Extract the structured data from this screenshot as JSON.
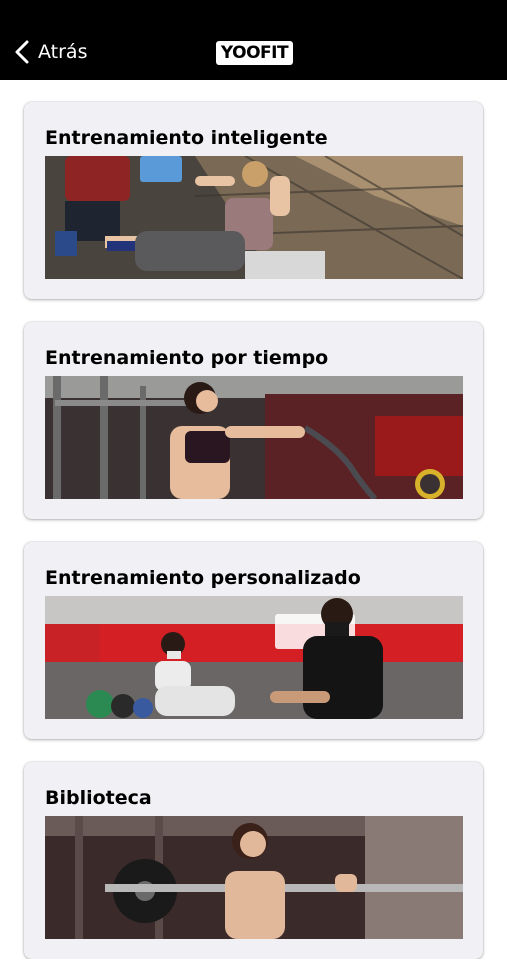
{
  "header": {
    "back_label": "Atrás",
    "logo_text": "YOOFIT"
  },
  "cards": [
    {
      "title": "Entrenamiento inteligente",
      "image": "woman doing sit-ups with trainer holding tablet"
    },
    {
      "title": "Entrenamiento por tiempo",
      "image": "woman training with battle rope in gym"
    },
    {
      "title": "Entrenamiento personalizado",
      "image": "masked trainer coaching woman doing squat"
    },
    {
      "title": "Biblioteca",
      "image": "woman lifting barbell in gym"
    }
  ],
  "colors": {
    "topbar": "#000000",
    "card_background": "#f1f0f4",
    "brand_red": "#d41f24"
  }
}
